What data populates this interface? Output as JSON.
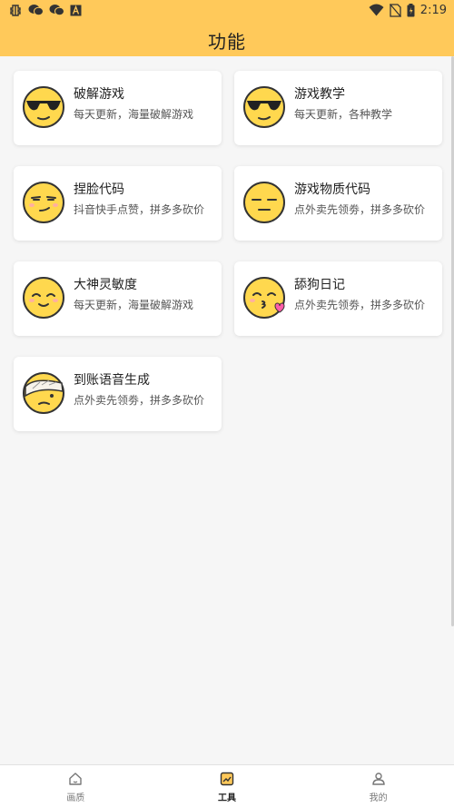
{
  "status_bar": {
    "time": "2:19",
    "left_icons": [
      "bug-icon",
      "wechat-icon",
      "wechat-icon",
      "font-icon"
    ],
    "right_icons": [
      "wifi-icon",
      "no-sim-icon",
      "battery-icon"
    ]
  },
  "header": {
    "title": "功能",
    "background": "#ffc95a"
  },
  "cards": [
    {
      "name": "破解游戏",
      "desc": "每天更新，海量破解游戏",
      "icon": "sunglasses-face-icon"
    },
    {
      "name": "游戏教学",
      "desc": "每天更新，各种教学",
      "icon": "sunglasses-face-icon"
    },
    {
      "name": "捏脸代码",
      "desc": "抖音快手点赞，拼多多砍价",
      "icon": "smirk-face-icon"
    },
    {
      "name": "游戏物质代码",
      "desc": "点外卖先领劵，拼多多砍价",
      "icon": "expressionless-face-icon"
    },
    {
      "name": "大神灵敏度",
      "desc": "每天更新，海量破解游戏",
      "icon": "wink-face-icon"
    },
    {
      "name": "舔狗日记",
      "desc": "点外卖先领劵，拼多多砍价",
      "icon": "kiss-face-icon"
    },
    {
      "name": "到账语音生成",
      "desc": "点外卖先领劵，拼多多砍价",
      "icon": "bandage-face-icon"
    }
  ],
  "bottom_nav": [
    {
      "label": "画质",
      "icon": "home-icon",
      "active": false
    },
    {
      "label": "工具",
      "icon": "tools-icon",
      "active": true
    },
    {
      "label": "我的",
      "icon": "user-icon",
      "active": false
    }
  ],
  "colors": {
    "accent": "#ffc95a",
    "face": "#ffd84e",
    "face_outline": "#333333",
    "kiss_heart": "#ff5ca8"
  }
}
